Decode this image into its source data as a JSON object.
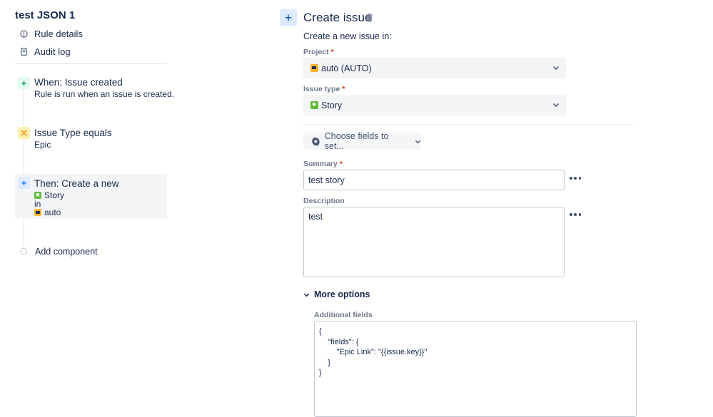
{
  "sidebar": {
    "rule_title": "test JSON 1",
    "rule_details": "Rule details",
    "audit_log": "Audit log",
    "components": {
      "trigger": {
        "title": "When: Issue created",
        "subtitle": "Rule is run when an issue is created."
      },
      "condition": {
        "title": "Issue Type equals",
        "subtitle": "Epic"
      },
      "action": {
        "title": "Then: Create a new",
        "issue_type": "Story",
        "in_text": "in",
        "project": "auto"
      }
    },
    "add_component": "Add component"
  },
  "panel": {
    "title": "Create issue",
    "subtitle": "Create a new issue in:",
    "project_label": "Project",
    "project_value": "auto (AUTO)",
    "issue_type_label": "Issue type",
    "issue_type_value": "Story",
    "required_mark": "*",
    "choose_fields": "Choose fields to set...",
    "summary_label": "Summary",
    "summary_value": "test story",
    "description_label": "Description",
    "description_value": "test",
    "more_options": "More options",
    "additional_fields_label": "Additional fields",
    "additional_fields_value": "{\n    \"fields\": {\n        \"Epic Link\": \"{{issue.key}}\"\n    }\n}"
  },
  "colors": {
    "accent": "#0052cc",
    "trigger_bg": "#e3fcef",
    "trigger_fg": "#00875a",
    "condition_bg": "#fff0b3",
    "condition_fg": "#ff8b00",
    "action_bg": "#deebff",
    "action_fg": "#0065ff"
  }
}
